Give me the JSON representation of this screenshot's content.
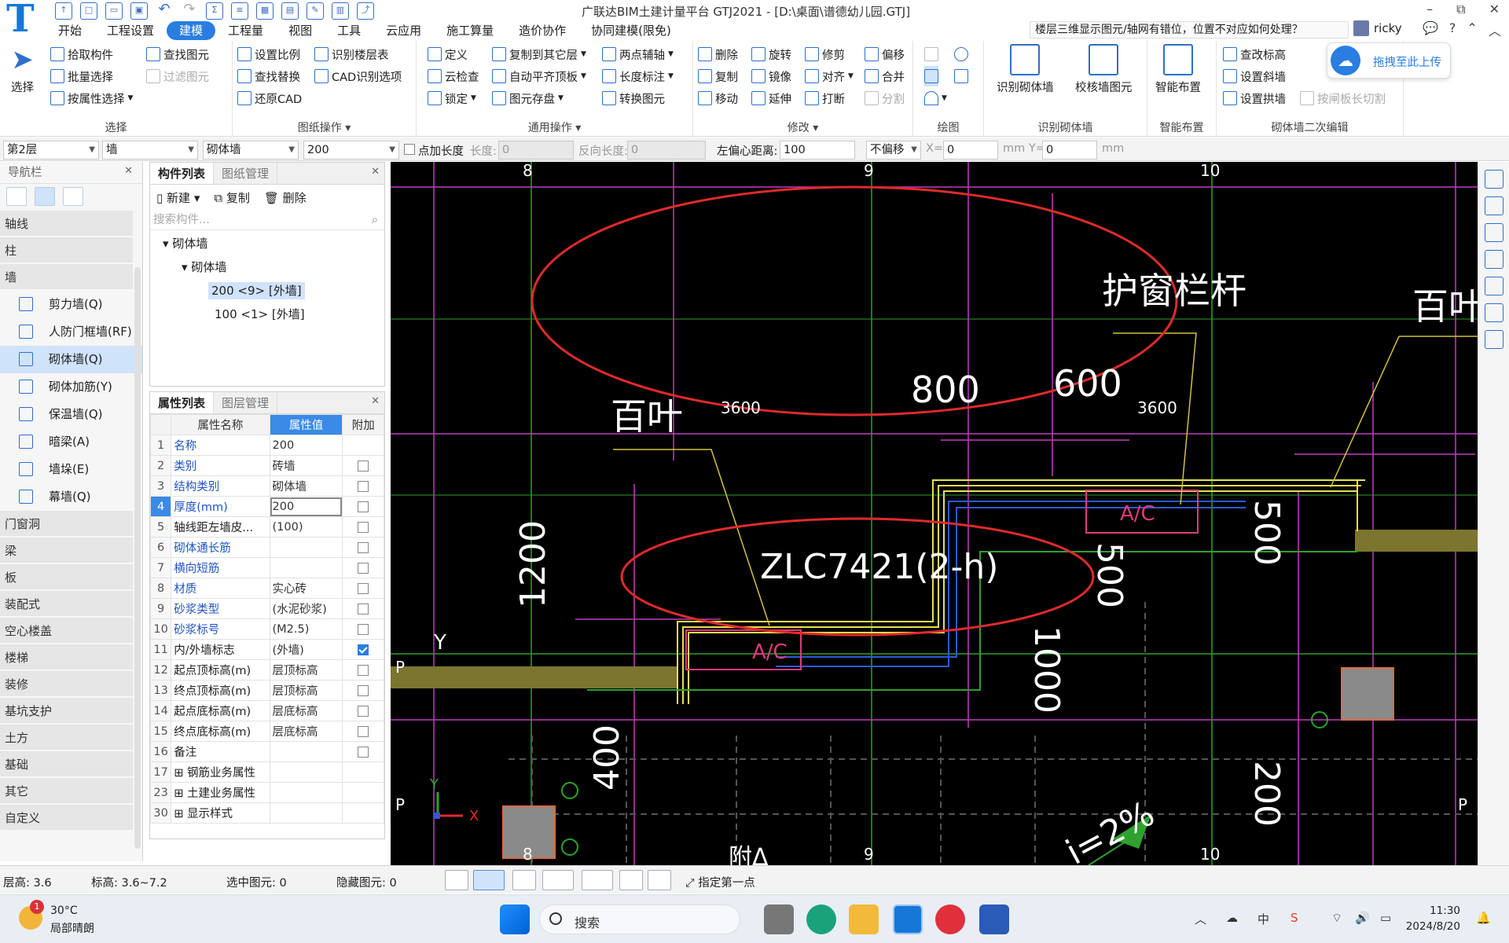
{
  "app": {
    "logo": "T",
    "title": "广联达BIM土建计量平台 GTJ2021 - [D:\\桌面\\谱德幼儿园.GTJ]",
    "help_question": "楼层三维显示图元/轴网有错位，位置不对应如何处理？",
    "user": "ricky",
    "win_min": "–",
    "win_max": "⧉",
    "win_close": "✕"
  },
  "menu": [
    "开始",
    "工程设置",
    "建模",
    "工程量",
    "视图",
    "工具",
    "云应用",
    "施工算量",
    "造价协作",
    "协同建模(限免)"
  ],
  "menu_active_index": 2,
  "ribbon": {
    "select": {
      "label": "选择",
      "big": "选择",
      "items": [
        "拾取构件",
        "批量选择",
        "按属性选择"
      ],
      "items2": [
        "查找图元",
        "过滤图元"
      ]
    },
    "drawing": {
      "label": "图纸操作",
      "items": [
        "设置比例",
        "查找替换",
        "还原CAD"
      ],
      "items2": [
        "识别楼层表",
        "CAD识别选项"
      ]
    },
    "general": {
      "label": "通用操作",
      "items": [
        "定义",
        "云检查",
        "锁定"
      ],
      "items2": [
        "复制到其它层",
        "自动平齐顶板",
        "图元存盘"
      ],
      "items3": [
        "两点辅轴",
        "长度标注",
        "转换图元"
      ]
    },
    "modify": {
      "label": "修改",
      "items": [
        "删除",
        "复制",
        "移动"
      ],
      "items2": [
        "旋转",
        "镜像",
        "延伸"
      ],
      "items3": [
        "修剪",
        "对齐",
        "打断"
      ],
      "items4": [
        "偏移",
        "合并",
        "分割"
      ]
    },
    "draw": {
      "label": "绘图"
    },
    "recognize": {
      "label": "识别砌体墙",
      "items": [
        "识别砌体墙",
        "校核墙图元"
      ]
    },
    "smart": {
      "label": "智能布置",
      "items": [
        "智能布置"
      ]
    },
    "secondary": {
      "label": "砌体墙二次编辑",
      "items": [
        "查改标高",
        "设置斜墙",
        "设置拱墙"
      ],
      "items2": [
        "按闸板长切割"
      ]
    }
  },
  "upload": {
    "label": "拖拽至此上传"
  },
  "propbar": {
    "floor": "第2层",
    "type": "墙",
    "sub": "砌体墙",
    "size": "200",
    "pt_len": "点加长度",
    "len_label": "长度:",
    "len_val": "0",
    "rev_label": "反向长度:",
    "rev_val": "0",
    "offset_label": "左偏心距离:",
    "offset_val": "100",
    "nooffset": "不偏移",
    "x_label": "X=",
    "x_val": "0",
    "y_label": "mm Y=",
    "y_val": "0",
    "mm": "mm"
  },
  "nav": {
    "title": "导航栏",
    "sections_top": [
      "轴线",
      "柱",
      "墙"
    ],
    "wall_items": [
      "剪力墙(Q)",
      "人防门框墙(RF)",
      "砌体墙(Q)",
      "砌体加筋(Y)",
      "保温墙(Q)",
      "暗梁(A)",
      "墙垛(E)",
      "幕墙(Q)"
    ],
    "wall_active_index": 2,
    "sections_bottom": [
      "门窗洞",
      "梁",
      "板",
      "装配式",
      "空心楼盖",
      "楼梯",
      "装修",
      "基坑支护",
      "土方",
      "基础",
      "其它",
      "自定义"
    ]
  },
  "components": {
    "tabs": [
      "构件列表",
      "图纸管理"
    ],
    "tools": [
      "新建",
      "复制",
      "删除"
    ],
    "search": "搜索构件...",
    "tree": {
      "root": "砌体墙",
      "group": "砌体墙",
      "items": [
        "200 <9> [外墙]",
        "100 <1> [外墙]"
      ],
      "selected_index": 0
    }
  },
  "properties": {
    "tabs": [
      "属性列表",
      "图层管理"
    ],
    "headers": [
      "属性名称",
      "属性值",
      "附加"
    ],
    "rows": [
      {
        "n": "1",
        "name": "名称",
        "value": "200",
        "blue": true,
        "check": null
      },
      {
        "n": "2",
        "name": "类别",
        "value": "砖墙",
        "blue": true,
        "check": false
      },
      {
        "n": "3",
        "name": "结构类别",
        "value": "砌体墙",
        "blue": true,
        "check": false
      },
      {
        "n": "4",
        "name": "厚度(mm)",
        "value": "200",
        "blue": true,
        "check": false,
        "sel": true
      },
      {
        "n": "5",
        "name": "轴线距左墙皮...",
        "value": "(100)",
        "blue": false,
        "check": false
      },
      {
        "n": "6",
        "name": "砌体通长筋",
        "value": "",
        "blue": true,
        "check": false
      },
      {
        "n": "7",
        "name": "横向短筋",
        "value": "",
        "blue": true,
        "check": false
      },
      {
        "n": "8",
        "name": "材质",
        "value": "实心砖",
        "blue": true,
        "check": false
      },
      {
        "n": "9",
        "name": "砂浆类型",
        "value": "(水泥砂浆)",
        "blue": true,
        "check": false
      },
      {
        "n": "10",
        "name": "砂浆标号",
        "value": "(M2.5)",
        "blue": true,
        "check": false
      },
      {
        "n": "11",
        "name": "内/外墙标志",
        "value": "(外墙)",
        "blue": false,
        "check": true
      },
      {
        "n": "12",
        "name": "起点顶标高(m)",
        "value": "层顶标高",
        "blue": false,
        "check": false
      },
      {
        "n": "13",
        "name": "终点顶标高(m)",
        "value": "层顶标高",
        "blue": false,
        "check": false
      },
      {
        "n": "14",
        "name": "起点底标高(m)",
        "value": "层底标高",
        "blue": false,
        "check": false
      },
      {
        "n": "15",
        "name": "终点底标高(m)",
        "value": "层底标高",
        "blue": false,
        "check": false
      },
      {
        "n": "16",
        "name": "备注",
        "value": "",
        "blue": false,
        "check": false
      },
      {
        "n": "17",
        "name": "钢筋业务属性",
        "value": "",
        "blue": false,
        "check": null,
        "expand": true
      },
      {
        "n": "23",
        "name": "土建业务属性",
        "value": "",
        "blue": false,
        "check": null,
        "expand": true
      },
      {
        "n": "30",
        "name": "显示样式",
        "value": "",
        "blue": false,
        "check": null,
        "expand": true
      }
    ]
  },
  "canvas": {
    "axis_8": "8",
    "axis_9": "9",
    "axis_10": "10",
    "axis_P": "P",
    "baiye": "百叶",
    "huchuang": "护窗栏杆",
    "d3600": "3600",
    "d800": "800",
    "d600": "600",
    "d1200": "1200",
    "d1000": "1000",
    "d500": "500",
    "d400": "400",
    "d200": "200",
    "ac": "A/C",
    "window": "ZLC7421(2-h)",
    "slope": "i=2%",
    "fu": "附Δ",
    "axis_x": "X",
    "axis_y": "Y"
  },
  "status": {
    "floor_h_label": "层高:",
    "floor_h": "3.6",
    "elev_label": "标高:",
    "elev": "3.6~7.2",
    "sel_label": "选中图元:",
    "sel": "0",
    "hidden_label": "隐藏图元:",
    "hidden": "0",
    "hint": "指定第一点"
  },
  "taskbar": {
    "badge": "1",
    "temp": "30°C",
    "weather": "局部晴朗",
    "search": "搜索",
    "ime": "中",
    "time": "11:30",
    "date": "2024/8/20"
  }
}
